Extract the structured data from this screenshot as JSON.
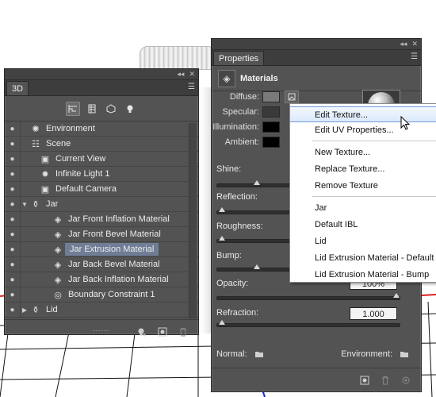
{
  "panel3d": {
    "tab_label": "3D",
    "layers": [
      {
        "label": "Environment",
        "icon": "environment-icon",
        "indent": 0,
        "twist": ""
      },
      {
        "label": "Scene",
        "icon": "scene-icon",
        "indent": 0,
        "twist": ""
      },
      {
        "label": "Current View",
        "icon": "camera-icon",
        "indent": 1,
        "twist": ""
      },
      {
        "label": "Infinite Light 1",
        "icon": "light-icon",
        "indent": 1,
        "twist": ""
      },
      {
        "label": "Default Camera",
        "icon": "camera-icon",
        "indent": 1,
        "twist": ""
      },
      {
        "label": "Jar",
        "icon": "mesh-icon",
        "indent": 0,
        "twist": "▼"
      },
      {
        "label": "Jar Front Inflation Material",
        "icon": "material-icon",
        "indent": 2,
        "twist": ""
      },
      {
        "label": "Jar Front Bevel Material",
        "icon": "material-icon",
        "indent": 2,
        "twist": ""
      },
      {
        "label": "Jar Extrusion Material",
        "icon": "material-icon",
        "indent": 2,
        "twist": "",
        "selected": true
      },
      {
        "label": "Jar Back Bevel Material",
        "icon": "material-icon",
        "indent": 2,
        "twist": ""
      },
      {
        "label": "Jar Back Inflation Material",
        "icon": "material-icon",
        "indent": 2,
        "twist": ""
      },
      {
        "label": "Boundary Constraint 1",
        "icon": "constraint-icon",
        "indent": 2,
        "twist": ""
      },
      {
        "label": "Lid",
        "icon": "mesh-icon",
        "indent": 0,
        "twist": "▶"
      }
    ]
  },
  "properties": {
    "tab_label": "Properties",
    "header_title": "Materials",
    "diffuse_label": "Diffuse:",
    "specular_label": "Specular:",
    "illumination_label": "Illumination:",
    "ambient_label": "Ambient:",
    "shine_label": "Shine:",
    "reflection_label": "Reflection:",
    "roughness_label": "Roughness:",
    "bump_label": "Bump:",
    "opacity_label": "Opacity:",
    "opacity_value": "100%",
    "refraction_label": "Refraction:",
    "refraction_value": "1.000",
    "normal_label": "Normal:",
    "environment_label": "Environment:",
    "colors": {
      "diffuse": "#7a7a7a",
      "specular": "#3a3a3a",
      "illumination": "#000000",
      "ambient": "#000000"
    }
  },
  "context_menu": {
    "items": [
      {
        "label": "Edit Texture...",
        "hover": true
      },
      {
        "label": "Edit UV Properties..."
      },
      {
        "label": "New Texture..."
      },
      {
        "label": "Replace Texture..."
      },
      {
        "label": "Remove Texture"
      },
      {
        "label": "Jar"
      },
      {
        "label": "Default IBL"
      },
      {
        "label": "Lid"
      },
      {
        "label": "Lid Extrusion Material - Default"
      },
      {
        "label": "Lid Extrusion Material - Bump"
      }
    ]
  },
  "accent": {
    "selection": "#6f7e96",
    "panel_bg": "#535353",
    "menu_highlight": "#6f9ad9"
  }
}
